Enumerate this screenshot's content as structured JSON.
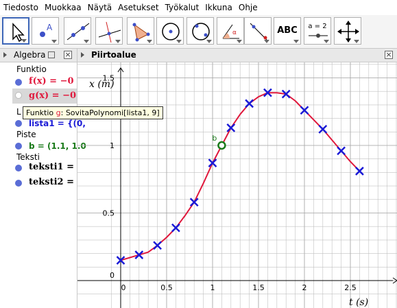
{
  "menu": [
    "Tiedosto",
    "Muokkaa",
    "Näytä",
    "Asetukset",
    "Työkalut",
    "Ikkuna",
    "Ohje"
  ],
  "toolbar": {
    "text_tool_label": "ABC",
    "slider_tool_label": "a = 2"
  },
  "algebra": {
    "title": "Algebra",
    "groups": [
      {
        "label": "Funktio"
      },
      {
        "label": "L"
      },
      {
        "label": "Piste"
      },
      {
        "label": "Teksti"
      }
    ],
    "items": {
      "f": "f(x) = −0",
      "g": "g(x) = −0",
      "lista1": "lista1 = {(0,",
      "b": "b = (1.1, 1.0",
      "teksti1": "teksti1 =",
      "teksti2": "teksti2 ="
    }
  },
  "tooltip": {
    "prefix": "Funktio ",
    "name": "g",
    "suffix": ": SovitaPolynomi[lista1, 9]"
  },
  "graphics": {
    "title": "Piirtoalue"
  },
  "chart_data": {
    "type": "scatter",
    "xlabel": "t (s)",
    "ylabel": "x (m)",
    "xlim": [
      -0.23,
      3.0
    ],
    "ylim": [
      -0.08,
      1.56
    ],
    "x_ticks": [
      0,
      0.5,
      1,
      1.5,
      2,
      2.5
    ],
    "x_tick_labels": [
      "0",
      "0.5",
      "1",
      "1.5",
      "2",
      "2.5"
    ],
    "y_ticks": [
      0,
      0.5,
      1,
      1.5
    ],
    "y_tick_labels": [
      "0",
      "0.5",
      "1",
      "1.5"
    ],
    "grid": true,
    "series": [
      {
        "name": "lista1",
        "color": "#1a1ad6",
        "marker": "x",
        "x": [
          0,
          0.2,
          0.4,
          0.6,
          0.8,
          1.0,
          1.2,
          1.4,
          1.6,
          1.8,
          2.0,
          2.2,
          2.4,
          2.6
        ],
        "y": [
          0.15,
          0.19,
          0.26,
          0.39,
          0.58,
          0.87,
          1.13,
          1.31,
          1.39,
          1.38,
          1.26,
          1.12,
          0.96,
          0.81
        ]
      }
    ],
    "fit_curve": {
      "color": "#e0183c",
      "x": [
        0,
        0.1,
        0.2,
        0.3,
        0.4,
        0.5,
        0.6,
        0.7,
        0.8,
        0.9,
        1.0,
        1.1,
        1.2,
        1.3,
        1.4,
        1.5,
        1.6,
        1.7,
        1.8,
        1.9,
        2.0,
        2.1,
        2.2,
        2.3,
        2.4,
        2.5,
        2.6
      ],
      "y": [
        0.15,
        0.17,
        0.19,
        0.21,
        0.26,
        0.32,
        0.39,
        0.48,
        0.58,
        0.72,
        0.87,
        1.0,
        1.13,
        1.23,
        1.31,
        1.36,
        1.39,
        1.39,
        1.38,
        1.33,
        1.26,
        1.19,
        1.12,
        1.04,
        0.96,
        0.88,
        0.81
      ]
    },
    "point_b": {
      "label": "b",
      "x": 1.1,
      "y": 1.0,
      "color": "#1a7a1a"
    }
  }
}
